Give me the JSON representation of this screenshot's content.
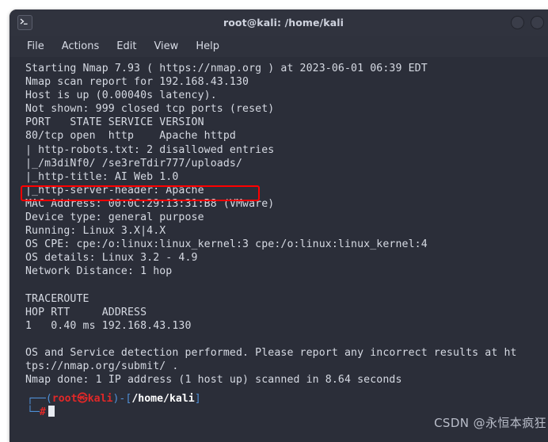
{
  "window": {
    "title": "root@kali: /home/kali",
    "icon": "terminal-icon",
    "buttons": [
      {
        "name": "minimize-button",
        "accent": false
      },
      {
        "name": "maximize-button",
        "accent": false
      },
      {
        "name": "close-button",
        "accent": true
      }
    ]
  },
  "menubar": {
    "items": [
      {
        "label": "File"
      },
      {
        "label": "Actions"
      },
      {
        "label": "Edit"
      },
      {
        "label": "View"
      },
      {
        "label": "Help"
      }
    ]
  },
  "terminal": {
    "lines": [
      "Starting Nmap 7.93 ( https://nmap.org ) at 2023-06-01 06:39 EDT",
      "Nmap scan report for 192.168.43.130",
      "Host is up (0.00040s latency).",
      "Not shown: 999 closed tcp ports (reset)",
      "PORT   STATE SERVICE VERSION",
      "80/tcp open  http    Apache httpd",
      "| http-robots.txt: 2 disallowed entries",
      "|_/m3diNf0/ /se3reTdir777/uploads/",
      "|_http-title: AI Web 1.0",
      "|_http-server-header: Apache",
      "MAC Address: 00:0C:29:13:31:B8 (VMware)",
      "Device type: general purpose",
      "Running: Linux 3.X|4.X",
      "OS CPE: cpe:/o:linux:linux_kernel:3 cpe:/o:linux:linux_kernel:4",
      "OS details: Linux 3.2 - 4.9",
      "Network Distance: 1 hop",
      "",
      "TRACEROUTE",
      "HOP RTT     ADDRESS",
      "1   0.40 ms 192.168.43.130",
      "",
      "OS and Service detection performed. Please report any incorrect results at ht",
      "tps://nmap.org/submit/ .",
      "Nmap done: 1 IP address (1 host up) scanned in 8.64 seconds"
    ],
    "highlight": {
      "name": "highlighted-port-line",
      "color": "#ff0000",
      "target_line": "80/tcp open  http    Apache httpd"
    },
    "prompt": {
      "branch_top": "┌──(",
      "user": "root",
      "at": "㉿",
      "host": "kali",
      "close_paren": ")-[",
      "path": "/home/kali",
      "close_bracket": "]",
      "branch_bottom": "└─",
      "symbol": "#"
    }
  },
  "watermark": {
    "text": "CSDN @永恒本疯狂"
  },
  "colors": {
    "terminal_bg": "#2b2e39",
    "titlebar_bg": "#30333e",
    "menubar_bg": "#2f323d",
    "text": "#d6dae3",
    "highlight": "#ff0000",
    "prompt_red": "#e02828",
    "prompt_blue": "#4f8fd6"
  }
}
